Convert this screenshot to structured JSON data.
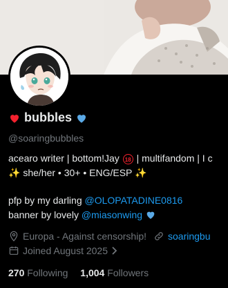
{
  "profile": {
    "name": "bubbles",
    "name_emoji_left": "❤️",
    "name_emoji_right": "💙",
    "handle": "@soaringbubbles",
    "bio_line1_pre": "acearo writer | bottom!Jay ",
    "bio_age_badge": "18",
    "bio_line1_post": " | multifandom | I c",
    "bio_line2": " she/her • 30+ • ENG/ESP ",
    "sparkle": "✨",
    "pfp_text": "pfp by my darling ",
    "pfp_mention": "@OLOPATADINE0816",
    "banner_text": "banner by lovely ",
    "banner_mention": "@miasonwing",
    "banner_emoji": "💙",
    "location": "Europa - Against censorship!",
    "website": "soaringbu",
    "joined": "Joined August 2025",
    "following_count": "270",
    "following_label": "Following",
    "followers_count": "1,004",
    "followers_label": "Followers"
  },
  "colors": {
    "background": "#000000",
    "text": "#e7e9ea",
    "muted": "#71767b",
    "link": "#1d9bf0",
    "heart_red": "#f4212e",
    "heart_blue": "#5aa9e6"
  },
  "icons": [
    "red-heart-icon",
    "blue-heart-icon",
    "location-pin-icon",
    "link-icon",
    "calendar-icon",
    "chevron-right-icon",
    "sparkle-icon",
    "age-18-icon"
  ]
}
